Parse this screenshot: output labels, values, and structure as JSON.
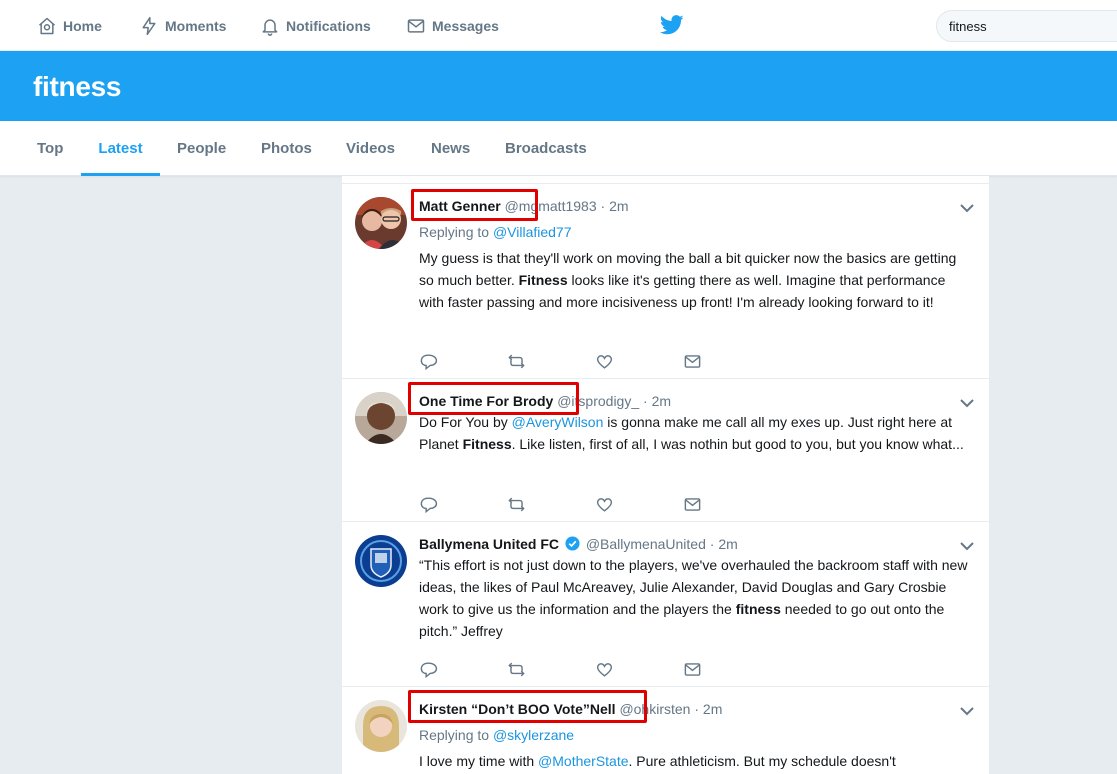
{
  "nav": {
    "home_label": "Home",
    "moments_label": "Moments",
    "notifications_label": "Notifications",
    "messages_label": "Messages",
    "search_value": "fitness",
    "brand_color": "#1da1f2"
  },
  "banner": {
    "title": "fitness"
  },
  "tabs": [
    {
      "label": "Top",
      "active": false
    },
    {
      "label": "Latest",
      "active": true
    },
    {
      "label": "People",
      "active": false
    },
    {
      "label": "Photos",
      "active": false
    },
    {
      "label": "Videos",
      "active": false
    },
    {
      "label": "News",
      "active": false
    },
    {
      "label": "Broadcasts",
      "active": false
    }
  ],
  "tweets": [
    {
      "name": "Matt Genner",
      "handle": "@mgmatt1983",
      "time": "2m",
      "replying_label": "Replying to",
      "replying_to": "@Villafied77",
      "text_a": "My guess is that they'll work on moving the ball a bit quicker now the basics are getting so much better. ",
      "text_bold": "Fitness",
      "text_b": " looks like it's getting there as well. Imagine that performance with faster passing and more incisiveness up front! I'm already looking forward to it!",
      "highlighted": true
    },
    {
      "name": "One Time For Brody",
      "handle": "@itsprodigy_",
      "time": "2m",
      "text_a": "Do For You by ",
      "text_link": "@AveryWilson",
      "text_b": " is gonna make me call all my exes up. Just right here at Planet ",
      "text_bold": "Fitness",
      "text_c": ". Like listen, first of all, I was nothin but good to you, but you know what...",
      "highlighted": true
    },
    {
      "name": "Ballymena United FC",
      "verified": true,
      "handle": "@BallymenaUnited",
      "time": "2m",
      "text_a": "“This effort is not just down to the players, we've overhauled the backroom staff with new ideas, the likes of Paul McAreavey, Julie Alexander, David Douglas and Gary Crosbie work to give us the information and the players the ",
      "text_bold": "fitness",
      "text_b": " needed to go out onto the pitch.” Jeffrey",
      "highlighted": false
    },
    {
      "name": "Kirsten “Don’t BOO Vote”Nell",
      "handle": "@ohkirsten",
      "time": "2m",
      "replying_label": "Replying to",
      "replying_to": "@skylerzane",
      "text_a": "I love my time with ",
      "text_link": "@MotherState",
      "text_b": ". Pure athleticism. But my schedule doesn't",
      "highlighted": true
    }
  ],
  "icons": {
    "reply": "reply-icon",
    "retweet": "retweet-icon",
    "like": "heart-icon",
    "dm": "envelope-icon",
    "caret": "chevron-down-icon"
  },
  "annotation_color": "#e00000"
}
